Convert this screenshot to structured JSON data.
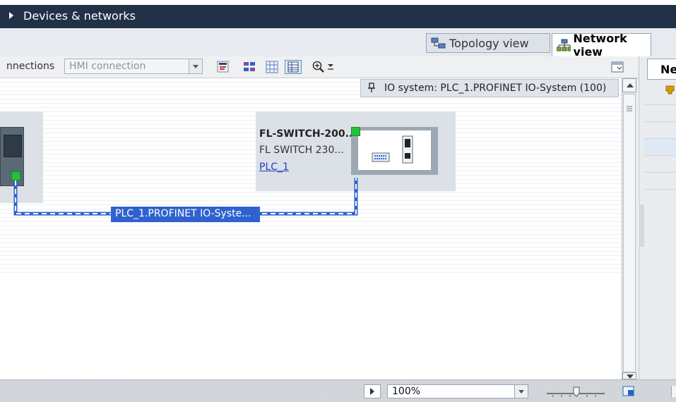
{
  "window": {
    "title": "Devices & networks"
  },
  "view_tabs": [
    {
      "label": "Topology view",
      "icon": "topology-icon",
      "active": false
    },
    {
      "label": "Network view",
      "icon": "network-icon",
      "active": true
    }
  ],
  "toolbar": {
    "connections_label": "nnections",
    "connection_type": "HMI connection"
  },
  "right_panel": {
    "tab_label": "Ne"
  },
  "io_system_banner": {
    "text": "IO system: PLC_1.PROFINET IO-System (100)"
  },
  "switch": {
    "name": "FL-SWITCH-200...",
    "type": "FL SWITCH 230...",
    "assigned_plc": "PLC_1"
  },
  "network": {
    "label": "PLC_1.PROFINET IO-Syste..."
  },
  "zoom": {
    "value": "100%"
  },
  "colors": {
    "network_line": "#2f62cf",
    "port_ok": "#22c33a",
    "titlebar": "#24354d"
  }
}
